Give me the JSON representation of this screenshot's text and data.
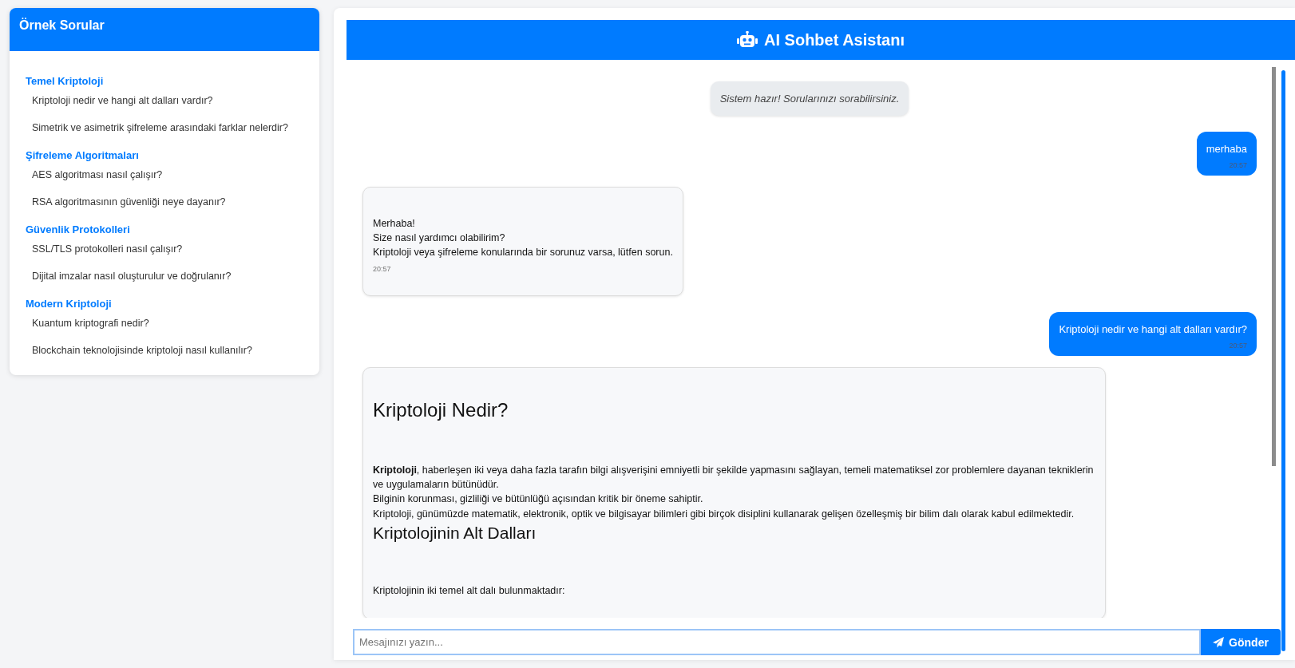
{
  "sidebar": {
    "title": "Örnek Sorular",
    "groups": [
      {
        "title": "Temel Kriptoloji",
        "questions": [
          "Kriptoloji nedir ve hangi alt dalları vardır?",
          "Simetrik ve asimetrik şifreleme arasındaki farklar nelerdir?"
        ]
      },
      {
        "title": "Şifreleme Algoritmaları",
        "questions": [
          "AES algoritması nasıl çalışır?",
          "RSA algoritmasının güvenliği neye dayanır?"
        ]
      },
      {
        "title": "Güvenlik Protokolleri",
        "questions": [
          "SSL/TLS protokolleri nasıl çalışır?",
          "Dijital imzalar nasıl oluşturulur ve doğrulanır?"
        ]
      },
      {
        "title": "Modern Kriptoloji",
        "questions": [
          "Kuantum kriptografi nedir?",
          "Blockchain teknolojisinde kriptoloji nasıl kullanılır?"
        ]
      }
    ]
  },
  "chat": {
    "title": "AI Sohbet Asistanı",
    "messages": [
      {
        "kind": "system",
        "text": "Sistem hazır! Sorularınızı sorabilirsiniz."
      },
      {
        "kind": "user",
        "text": "merhaba",
        "time": "20:57"
      },
      {
        "kind": "bot",
        "blocks": [
          {
            "kind": "p",
            "lines": [
              "Merhaba!",
              "Size nasıl yardımcı olabilirim?",
              "Kriptoloji veya şifreleme konularında bir sorunuz varsa, lütfen sorun."
            ]
          }
        ],
        "time": "20:57"
      },
      {
        "kind": "user",
        "text": "Kriptoloji nedir ve hangi alt dalları vardır?",
        "time": "20:57"
      },
      {
        "kind": "bot",
        "blocks": [
          {
            "kind": "h2",
            "text": "Kriptoloji Nedir?"
          },
          {
            "kind": "p",
            "lines": [
              "**Kriptoloji**, haberleşen iki veya daha fazla tarafın bilgi alışverişini emniyetli bir şekilde yapmasını sağlayan, temeli matematiksel zor problemlere dayanan tekniklerin ve uygulamaların bütünüdür.",
              "Bilginin korunması, gizliliği ve bütünlüğü açısından kritik bir öneme sahiptir.",
              "Kriptoloji, günümüzde matematik, elektronik, optik ve bilgisayar bilimleri gibi birçok disiplini kullanarak gelişen özelleşmiş bir bilim dalı olarak kabul edilmektedir."
            ]
          },
          {
            "kind": "h3",
            "text": "Kriptolojinin Alt Dalları"
          },
          {
            "kind": "p",
            "lines": [
              "Kriptolojinin iki temel alt dalı bulunmaktadır:"
            ]
          }
        ]
      }
    ],
    "input": {
      "placeholder": "Mesajınızı yazın..."
    },
    "send_button": "Gönder"
  }
}
